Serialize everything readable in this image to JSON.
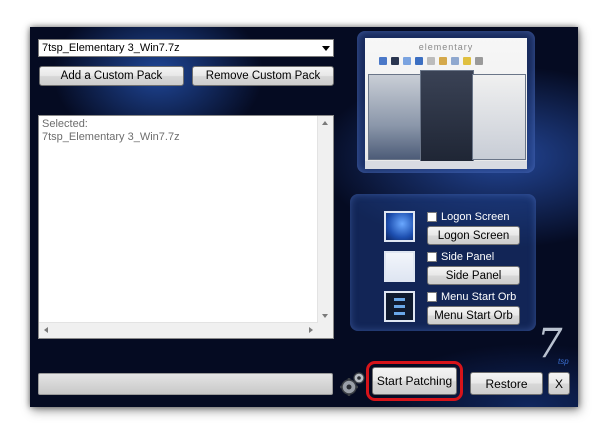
{
  "pack_selector": {
    "value": "7tsp_Elementary 3_Win7.7z"
  },
  "buttons": {
    "add_custom_pack": "Add a Custom Pack",
    "remove_custom_pack": "Remove Custom Pack",
    "start_patching": "Start Patching",
    "restore": "Restore",
    "close": "X"
  },
  "info_list": {
    "lines": [
      "Selected:",
      "7tsp_Elementary 3_Win7.7z"
    ]
  },
  "preview": {
    "title": "elementary"
  },
  "options": [
    {
      "checkbox_label": "Logon Screen",
      "button_label": "Logon Screen",
      "checked": false
    },
    {
      "checkbox_label": "Side Panel",
      "button_label": "Side Panel",
      "checked": false
    },
    {
      "checkbox_label": "Menu Start Orb",
      "button_label": "Menu Start Orb",
      "checked": false
    }
  ],
  "progress": {
    "value": 0
  },
  "brand": {
    "logo": "7",
    "logo_sub": "tsp"
  },
  "colors": {
    "highlight": "#d7141a",
    "background": "#050b22"
  }
}
